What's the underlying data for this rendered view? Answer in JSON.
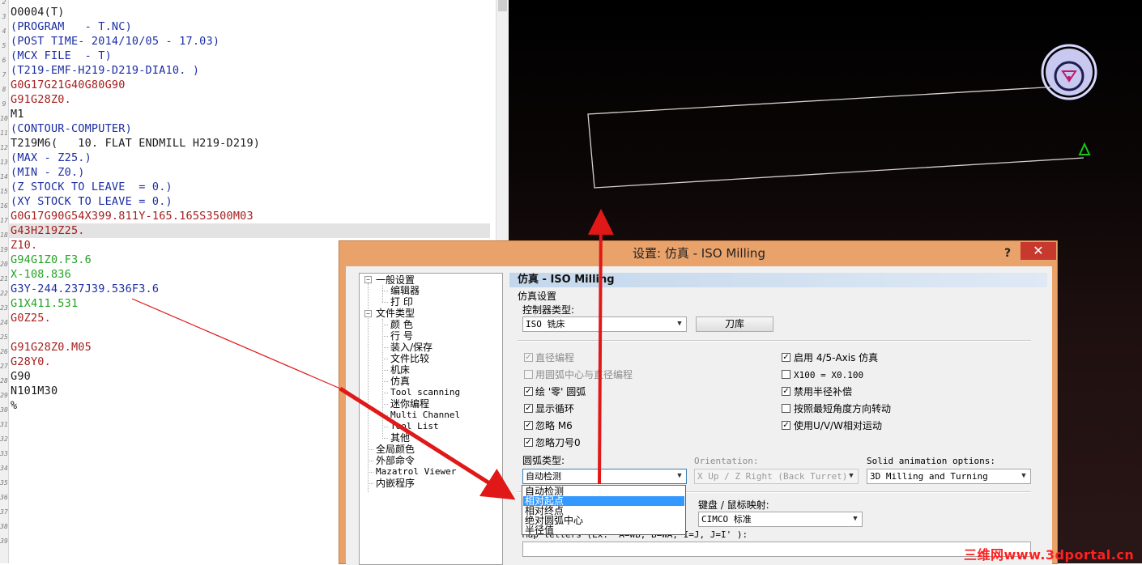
{
  "editor": {
    "code_lines": [
      {
        "text": "O0004(T)",
        "color": "#1a1a1a"
      },
      {
        "text": "(PROGRAM   - T.NC)",
        "color": "#1c2ea3"
      },
      {
        "text": "(POST TIME- 2014/10/05 - 17.03)",
        "color": "#1c2ea3"
      },
      {
        "text": "(MCX FILE  - T)",
        "color": "#1c2ea3"
      },
      {
        "text": "(T219-EMF-H219-D219-DIA10. )",
        "color": "#1c2ea3"
      },
      {
        "text": "G0G17G21G40G80G90",
        "color": "#a51e1e"
      },
      {
        "text": "G91G28Z0.",
        "color": "#a51e1e"
      },
      {
        "text": "M1",
        "color": "#1a1a1a"
      },
      {
        "text": "(CONTOUR-COMPUTER)",
        "color": "#1c2ea3"
      },
      {
        "text": "T219M6(   10. FLAT ENDMILL H219-D219)",
        "color": "#1a1a1a"
      },
      {
        "text": "(MAX - Z25.)",
        "color": "#1c2ea3"
      },
      {
        "text": "(MIN - Z0.)",
        "color": "#1c2ea3"
      },
      {
        "text": "(Z STOCK TO LEAVE  = 0.)",
        "color": "#1c2ea3"
      },
      {
        "text": "(XY STOCK TO LEAVE = 0.)",
        "color": "#1c2ea3"
      },
      {
        "text": "G0G17G90G54X399.811Y-165.165S3500M03",
        "color": "#a51e1e"
      },
      {
        "text": "G43H219Z25.",
        "color": "#a51e1e"
      },
      {
        "text": "Z10.",
        "color": "#a51e1e"
      },
      {
        "text": "G94G1Z0.F3.6",
        "color": "#23a323"
      },
      {
        "text": "X-108.836",
        "color": "#23a323"
      },
      {
        "text": "G3Y-244.237J39.536F3.6",
        "color": "#1c2ea3"
      },
      {
        "text": "G1X411.531",
        "color": "#23a323"
      },
      {
        "text": "G0Z25.",
        "color": "#a51e1e"
      },
      {
        "text": "",
        "color": "#1a1a1a"
      },
      {
        "text": "G91G28Z0.M05",
        "color": "#a51e1e"
      },
      {
        "text": "G28Y0.",
        "color": "#a51e1e"
      },
      {
        "text": "G90",
        "color": "#1a1a1a"
      },
      {
        "text": "N101M30",
        "color": "#1a1a1a"
      },
      {
        "text": "%",
        "color": "#1a1a1a"
      }
    ],
    "line_numbers": [
      "2",
      "3",
      "4",
      "5",
      "6",
      "7",
      "8",
      "9",
      "10",
      "11",
      "12",
      "13",
      "14",
      "15",
      "16",
      "17",
      "18",
      "19",
      "20",
      "21",
      "22",
      "23",
      "24",
      "25",
      "26",
      "27",
      "28",
      "29",
      "30",
      "31",
      "32",
      "33",
      "34",
      "35",
      "36",
      "37",
      "38",
      "39"
    ],
    "highlighted_line": 15
  },
  "dialog": {
    "title": "设置: 仿真 - ISO Milling",
    "help_label": "?",
    "close_label": "✕",
    "tree": {
      "general": "一般设置",
      "general_children": [
        "编辑器",
        "打  印"
      ],
      "filetype": "文件类型",
      "filetype_children": [
        "颜  色",
        "行  号",
        "装入/保存",
        "文件比较",
        "机床",
        "仿真",
        "Tool scanning",
        "迷你编程",
        "Multi Channel",
        "Tool List",
        "其他"
      ],
      "roots": [
        "全局颜色",
        "外部命令",
        "Mazatrol Viewer",
        "内嵌程序"
      ]
    },
    "panel": {
      "header": "仿真 - ISO Milling",
      "section_label": "仿真设置",
      "controller_label": "控制器类型:",
      "controller_value": "ISO 铣床",
      "tool_library_button": "刀库",
      "left_checks": [
        {
          "label": "直径编程",
          "checked": true,
          "disabled": true
        },
        {
          "label": "用圆弧中心与直径编程",
          "checked": false,
          "disabled": true
        },
        {
          "label": "绘 '零' 圆弧",
          "checked": true,
          "disabled": false
        },
        {
          "label": "显示循环",
          "checked": true,
          "disabled": false
        },
        {
          "label": "忽略 M6",
          "checked": true,
          "disabled": false
        },
        {
          "label": "忽略刀号0",
          "checked": true,
          "disabled": false
        }
      ],
      "right_checks": [
        {
          "label": "启用 4/5-Axis 仿真",
          "checked": true
        },
        {
          "label": "X100 = X0.100",
          "checked": false
        },
        {
          "label": "禁用半径补偿",
          "checked": true
        },
        {
          "label": "按照最短角度方向转动",
          "checked": false
        },
        {
          "label": "使用U/V/W相对运动",
          "checked": true
        }
      ],
      "arc_type_label": "圆弧类型:",
      "arc_type_value": "自动检测",
      "orientation_label": "Orientation:",
      "orientation_value": "X Up   / Z Right (Back Turret)",
      "solid_anim_label": "Solid animation options:",
      "solid_anim_value": "3D Milling and Turning",
      "keyboard_label": "键盘 / 鼠标映射:",
      "keyboard_value": "CIMCO 标准",
      "map_letters_label": "Map letters (Ex: 'A=WB, B=WA, I=J, J=I' ):",
      "map_letters_value": ""
    },
    "arc_dropdown": {
      "options": [
        "自动检测",
        "相对起点",
        "相对终点",
        "绝对圆弧中心",
        "半径值"
      ],
      "selected_index": 1
    }
  },
  "watermark": "三维网www.3dportal.cn",
  "colors": {
    "arrow": "#e01818",
    "tool_circle": "#c8c8f0",
    "tool_mark": "#c0186e",
    "start_marker": "#14c814",
    "panel_header": "#c3d7ec",
    "dialog_frame": "#e9a26a",
    "close_button": "#c7382d",
    "dropdown_selected": "#3399ff"
  }
}
